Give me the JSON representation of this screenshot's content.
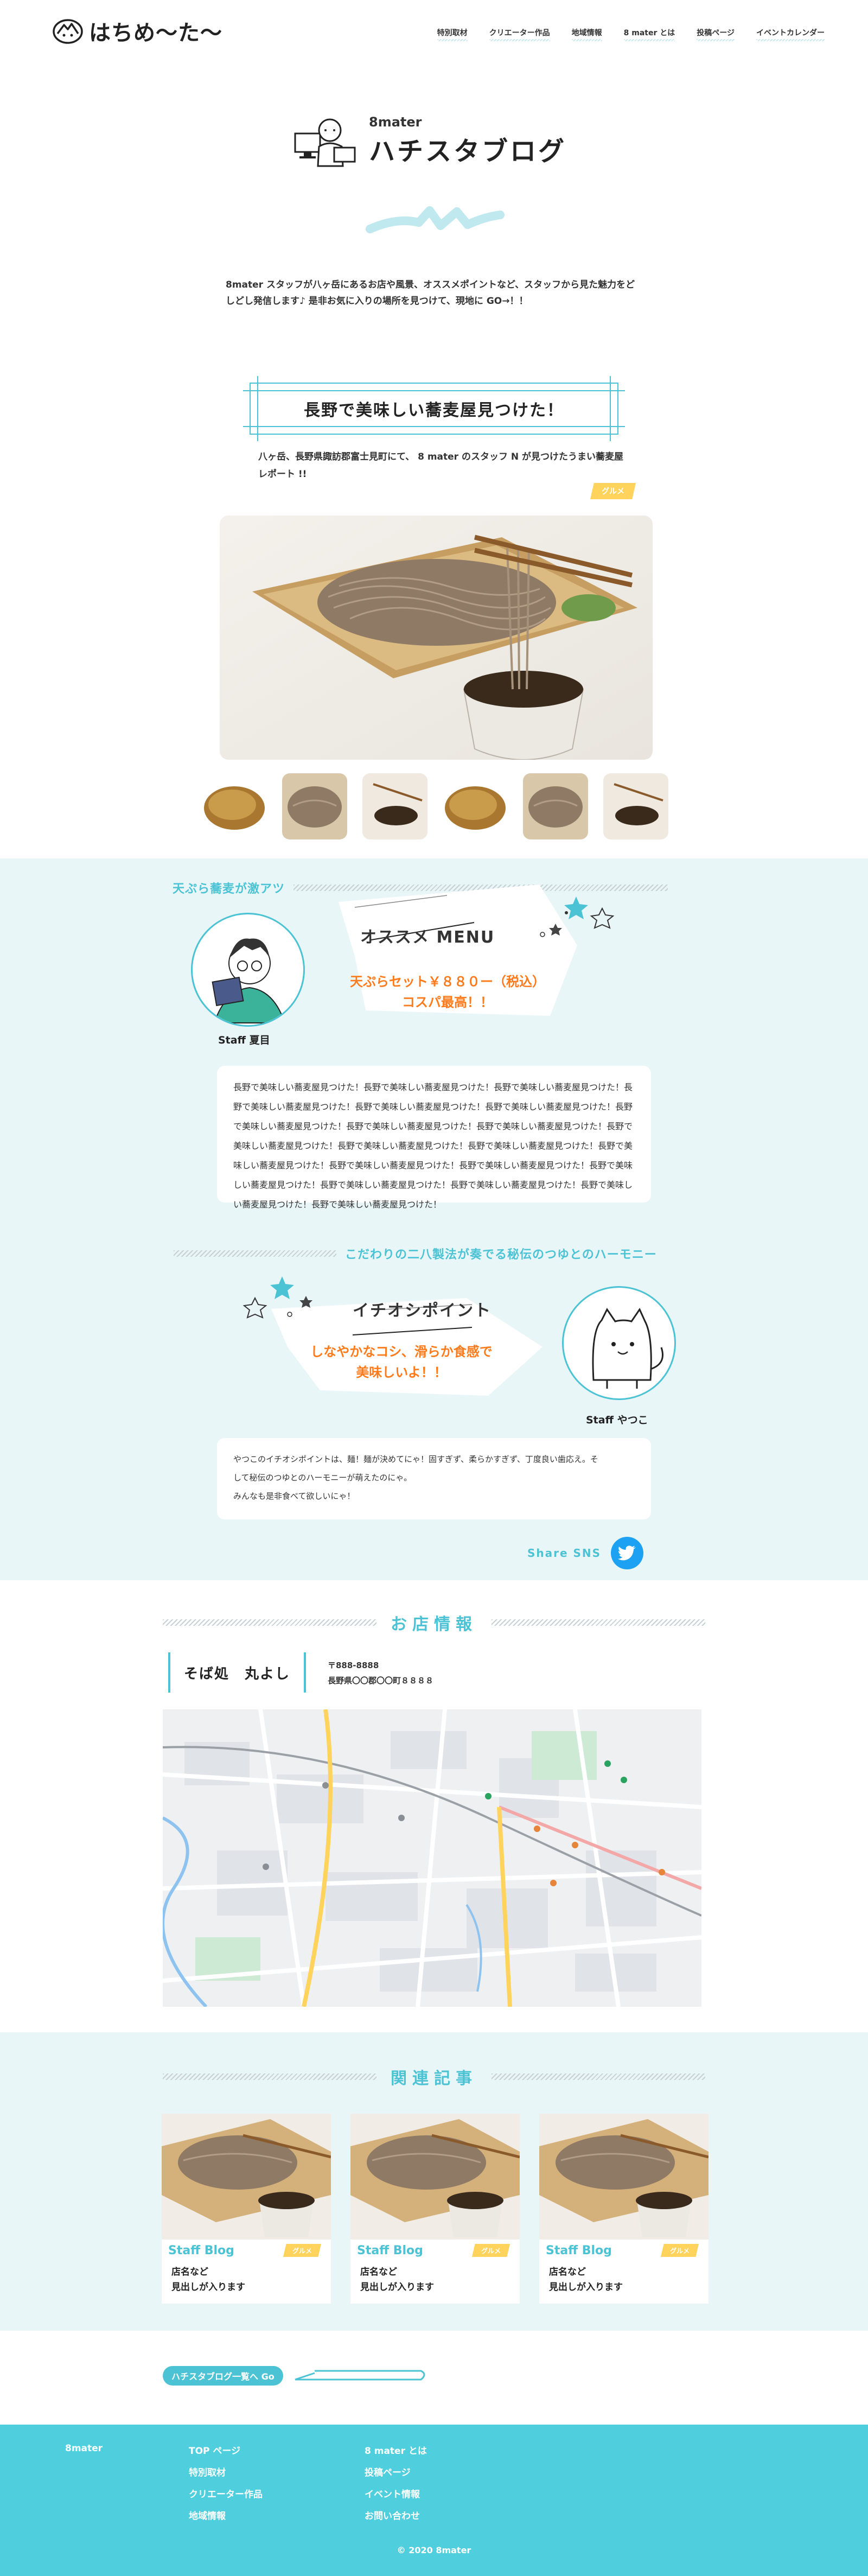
{
  "brand": {
    "logo_text": "はちめ〜た〜"
  },
  "nav": [
    "特別取材",
    "クリエーター作品",
    "地域情報",
    "8 mater とは",
    "投稿ページ",
    "イベントカレンダー"
  ],
  "blog": {
    "sub": "8mater",
    "title": "ハチスタブログ",
    "intro": "8mater スタッフが八ヶ岳にあるお店や風景、オススメポイントなど、スタッフから見た魅力をどしどし発信します♪ 是非お気に入りの場所を見つけて、現地に GO→！！"
  },
  "article": {
    "title": "長野で美味しい蕎麦屋見つけた！",
    "lead": "八ヶ岳、長野県諏訪郡富士見町にて、 8 mater のスタッフ N が見つけたうまい蕎麦屋レポート !!",
    "tag": "グルメ"
  },
  "section1": {
    "heading": "天ぷら蕎麦が激アツ",
    "staff_name": "Staff 夏目",
    "bubble_title": "オススメ MENU",
    "bubble_text_1": "天ぷらセット￥８８０ー（税込）",
    "bubble_text_2": "コスパ最高！！",
    "body": "長野で美味しい蕎麦屋見つけた！長野で美味しい蕎麦屋見つけた！長野で美味しい蕎麦屋見つけた！長野で美味しい蕎麦屋見つけた！長野で美味しい蕎麦屋見つけた！長野で美味しい蕎麦屋見つけた！長野で美味しい蕎麦屋見つけた！長野で美味しい蕎麦屋見つけた！長野で美味しい蕎麦屋見つけた！長野で美味しい蕎麦屋見つけた！長野で美味しい蕎麦屋見つけた！長野で美味しい蕎麦屋見つけた！長野で美味しい蕎麦屋見つけた！長野で美味しい蕎麦屋見つけた！長野で美味しい蕎麦屋見つけた！長野で美味しい蕎麦屋見つけた！長野で美味しい蕎麦屋見つけた！長野で美味しい蕎麦屋見つけた！長野で美味しい蕎麦屋見つけた！長野で美味しい蕎麦屋見つけた！"
  },
  "section2": {
    "heading": "こだわりの二八製法が奏でる秘伝のつゆとのハーモニー",
    "staff_name": "Staff やつこ",
    "bubble_title": "イチオシポイント",
    "bubble_text_1": "しなやかなコシ、滑らか食感で",
    "bubble_text_2": "美味しいよ！！",
    "body_1": "やつこのイチオシポイントは、麺！麺が決めてにゃ！固すぎず、柔らかすぎず、丁度良い歯応え。そ",
    "body_2": "して秘伝のつゆとのハーモニーが萌えたのにゃ。",
    "body_3": "みんなも是非食べて欲しいにゃ！"
  },
  "share": {
    "label": "Share SNS"
  },
  "shop": {
    "heading": "お店情報",
    "name": "そば処　丸よし",
    "postal": "〒888-8888",
    "address": "長野県〇〇郡〇〇町８８８８"
  },
  "related": {
    "heading": "関連記事",
    "cards": [
      {
        "category": "Staff Blog",
        "tag": "グルメ",
        "line1": "店名など",
        "line2": "見出しが入ります"
      },
      {
        "category": "Staff Blog",
        "tag": "グルメ",
        "line1": "店名など",
        "line2": "見出しが入ります"
      },
      {
        "category": "Staff Blog",
        "tag": "グルメ",
        "line1": "店名など",
        "line2": "見出しが入ります"
      }
    ]
  },
  "list_link": "ハチスタブログ一覧へ Go",
  "footer": {
    "brand": "8mater",
    "col1": [
      "TOP ページ",
      "特別取材",
      "クリエーター作品",
      "地域情報"
    ],
    "col2": [
      "8 mater とは",
      "投稿ページ",
      "イベント情報",
      "お問い合わせ"
    ],
    "copyright": "© 2020 8mater"
  },
  "colors": {
    "accent": "#4bc3d4",
    "orange": "#ff7a1a",
    "yellow": "#ffd35c",
    "footer": "#4fcfdd",
    "bg_light": "#e9f6f8"
  }
}
